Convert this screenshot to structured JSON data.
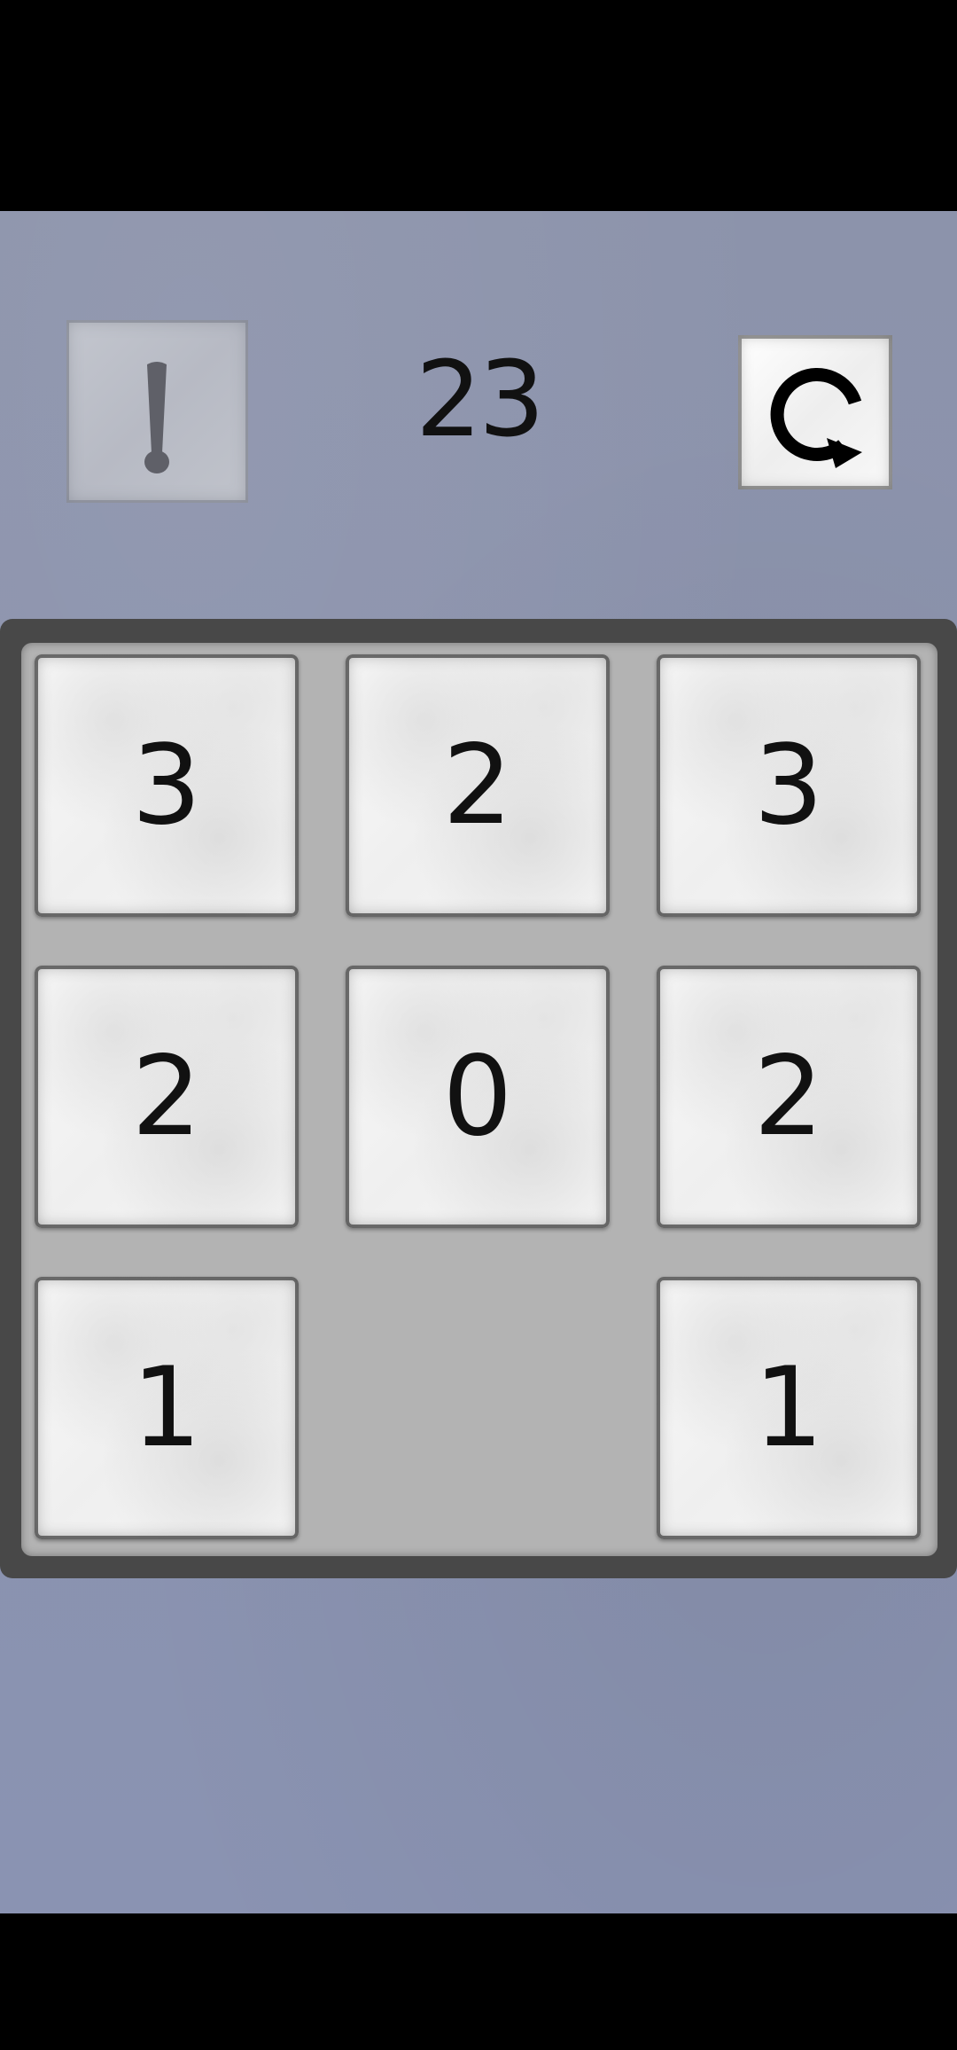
{
  "game": {
    "move_count": "23"
  },
  "toolbar": {
    "hint_icon": "exclamation-icon",
    "restart_icon": "restart-icon"
  },
  "board": {
    "rows": 3,
    "cols": 3,
    "tiles": [
      {
        "row": 1,
        "col": 1,
        "value": "3"
      },
      {
        "row": 1,
        "col": 2,
        "value": "2"
      },
      {
        "row": 1,
        "col": 3,
        "value": "3"
      },
      {
        "row": 2,
        "col": 1,
        "value": "2"
      },
      {
        "row": 2,
        "col": 2,
        "value": "0"
      },
      {
        "row": 2,
        "col": 3,
        "value": "2"
      },
      {
        "row": 3,
        "col": 1,
        "value": "1"
      },
      {
        "row": 3,
        "col": 2,
        "value": null
      },
      {
        "row": 3,
        "col": 3,
        "value": "1"
      }
    ]
  },
  "colors": {
    "background": "#8b92ad",
    "board_frame": "#484848",
    "board_inner": "#b3b3b3",
    "tile": "#f5f5f5",
    "text": "#111111"
  }
}
